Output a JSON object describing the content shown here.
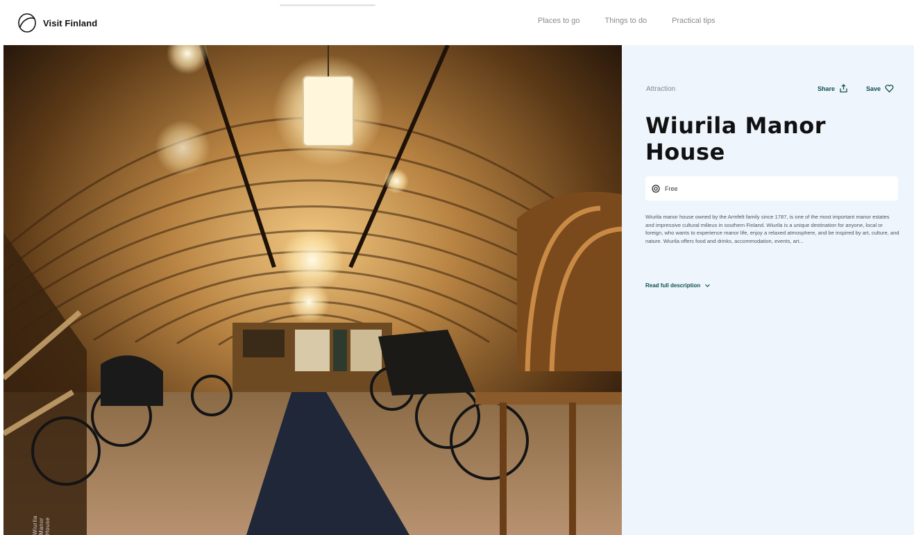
{
  "brand": {
    "name": "Visit Finland"
  },
  "nav": {
    "items": [
      {
        "label": "Places to go"
      },
      {
        "label": "Things to do"
      },
      {
        "label": "Practical tips"
      }
    ]
  },
  "hero": {
    "image_alt": "Carriage museum in the wooden attic of Wiurila Manor House",
    "credit": "Wiurila Manor House"
  },
  "detail": {
    "category": "Attraction",
    "share_label": "Share",
    "save_label": "Save",
    "title": "Wiurila Manor House",
    "price": "Free",
    "description": "Wiurila manor house owned by the Armfelt family since 1787, is one of the most important manor estates and impressive cultural milieus in southern Finland. Wiurila is a unique destination for anyone, local or foreign, who wants to experience manor life, enjoy a relaxed atmosphere, and be inspired by art, culture, and nature. Wiurila offers food and drinks, accommodation, events, art...",
    "read_more_label": "Read full description"
  },
  "colors": {
    "panel_background": "#eef5fd",
    "accent": "#0f4f4e",
    "title": "#111111",
    "nav_text": "#8a8a8a"
  }
}
